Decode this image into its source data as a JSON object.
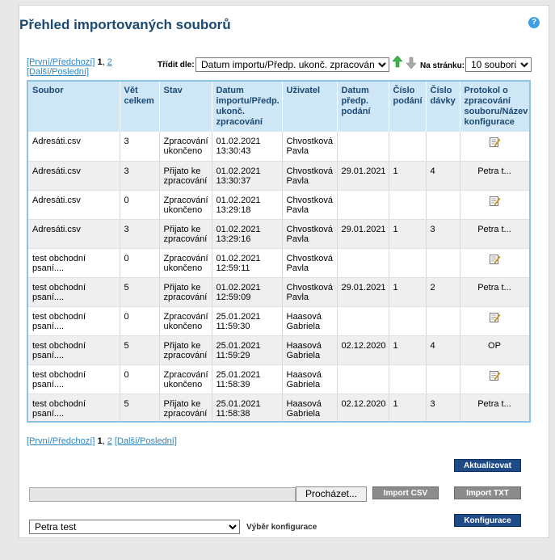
{
  "title": "Přehled importovaných souborů",
  "help_icon": "?",
  "pager_top": {
    "first_prev": "[První/Předchozí]",
    "page1": "1",
    "sep": ",",
    "page2": "2",
    "next_last": "[Další/Poslední]"
  },
  "pager_bottom": {
    "first_prev": "[První/Předchozí]",
    "page1": "1",
    "sep": ",",
    "page2": "2",
    "next_last": "[Další/Poslední]"
  },
  "sort": {
    "label": "Třídit dle:",
    "value": "Datum importu/Předp. ukonč. zpracování"
  },
  "per_page": {
    "label": "Na stránku:",
    "value": "10 souborů"
  },
  "colors": {
    "accent": "#1a4a73",
    "header_bg": "#cfe6f6",
    "button": "#1e4b87",
    "button_disabled": "#8c8c8c"
  },
  "columns": [
    "Soubor",
    "Vět celkem",
    "Stav",
    "Datum importu/Předp. ukonč. zpracování",
    "Uživatel",
    "Datum předp. podání",
    "Číslo podání",
    "Číslo dávky",
    "Protokol o zpracování souboru/Název konfigurace"
  ],
  "rows": [
    {
      "file": "Adresáti.csv",
      "count": "3",
      "status": "Zpracování ukončeno",
      "date": "01.02.2021 13:30:43",
      "user": "Chvostková Pavla",
      "submit_date": "",
      "submit_no": "",
      "batch_no": "",
      "protocol": "",
      "protocol_icon": "edit-icon"
    },
    {
      "file": "Adresáti.csv",
      "count": "3",
      "status": "Přijato ke zpracování",
      "date": "01.02.2021 13:30:37",
      "user": "Chvostková Pavla",
      "submit_date": "29.01.2021",
      "submit_no": "1",
      "batch_no": "4",
      "protocol": "Petra t...",
      "protocol_icon": ""
    },
    {
      "file": "Adresáti.csv",
      "count": "0",
      "status": "Zpracování ukončeno",
      "date": "01.02.2021 13:29:18",
      "user": "Chvostková Pavla",
      "submit_date": "",
      "submit_no": "",
      "batch_no": "",
      "protocol": "",
      "protocol_icon": "edit-icon"
    },
    {
      "file": "Adresáti.csv",
      "count": "3",
      "status": "Přijato ke zpracování",
      "date": "01.02.2021 13:29:16",
      "user": "Chvostková Pavla",
      "submit_date": "29.01.2021",
      "submit_no": "1",
      "batch_no": "3",
      "protocol": "Petra t...",
      "protocol_icon": ""
    },
    {
      "file": "test obchodní psaní....",
      "count": "0",
      "status": "Zpracování ukončeno",
      "date": "01.02.2021 12:59:11",
      "user": "Chvostková Pavla",
      "submit_date": "",
      "submit_no": "",
      "batch_no": "",
      "protocol": "",
      "protocol_icon": "edit-icon"
    },
    {
      "file": "test obchodní psaní....",
      "count": "5",
      "status": "Přijato ke zpracování",
      "date": "01.02.2021 12:59:09",
      "user": "Chvostková Pavla",
      "submit_date": "29.01.2021",
      "submit_no": "1",
      "batch_no": "2",
      "protocol": "Petra t...",
      "protocol_icon": ""
    },
    {
      "file": "test obchodní psaní....",
      "count": "0",
      "status": "Zpracování ukončeno",
      "date": "25.01.2021 11:59:30",
      "user": "Haasová Gabriela",
      "submit_date": "",
      "submit_no": "",
      "batch_no": "",
      "protocol": "",
      "protocol_icon": "edit-icon"
    },
    {
      "file": "test obchodní psaní....",
      "count": "5",
      "status": "Přijato ke zpracování",
      "date": "25.01.2021 11:59:29",
      "user": "Haasová Gabriela",
      "submit_date": "02.12.2020",
      "submit_no": "1",
      "batch_no": "4",
      "protocol": "OP",
      "protocol_icon": ""
    },
    {
      "file": "test obchodní psaní....",
      "count": "0",
      "status": "Zpracování ukončeno",
      "date": "25.01.2021 11:58:39",
      "user": "Haasová Gabriela",
      "submit_date": "",
      "submit_no": "",
      "batch_no": "",
      "protocol": "",
      "protocol_icon": "edit-icon"
    },
    {
      "file": "test obchodní psaní....",
      "count": "5",
      "status": "Přijato ke zpracování",
      "date": "25.01.2021 11:58:38",
      "user": "Haasová Gabriela",
      "submit_date": "02.12.2020",
      "submit_no": "1",
      "batch_no": "3",
      "protocol": "Petra t...",
      "protocol_icon": ""
    }
  ],
  "buttons": {
    "refresh": "Aktualizovat",
    "browse": "Procházet...",
    "import_csv": "Import CSV",
    "import_txt": "Import TXT",
    "config": "Konfigurace"
  },
  "config": {
    "value": "Petra test",
    "label": "Výběr konfigurace"
  }
}
